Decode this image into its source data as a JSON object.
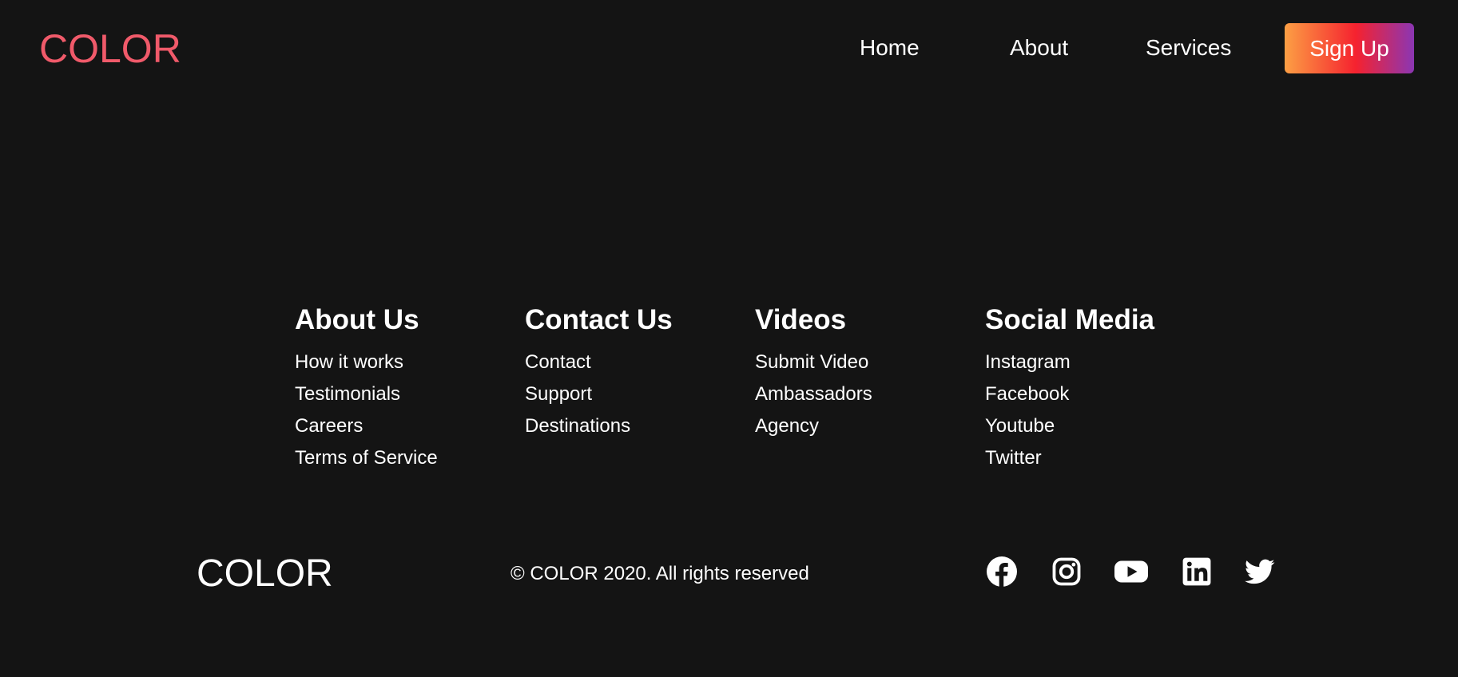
{
  "navbar": {
    "logo": "COLOR",
    "logo_color": "#f05a6a",
    "links": [
      "Home",
      "About",
      "Services"
    ],
    "signup_label": "Sign Up",
    "signup_gradient": [
      "#fc9f44",
      "#f5222f",
      "#8b36b3"
    ]
  },
  "footer": {
    "columns": [
      {
        "title": "About Us",
        "links": [
          "How it works",
          "Testimonials",
          "Careers",
          "Terms of Service"
        ]
      },
      {
        "title": "Contact Us",
        "links": [
          "Contact",
          "Support",
          "Destinations"
        ]
      },
      {
        "title": "Videos",
        "links": [
          "Submit Video",
          "Ambassadors",
          "Agency"
        ]
      },
      {
        "title": "Social Media",
        "links": [
          "Instagram",
          "Facebook",
          "Youtube",
          "Twitter"
        ]
      }
    ],
    "logo": "COLOR",
    "copyright": "© COLOR 2020. All rights reserved",
    "social_icons": [
      "facebook-icon",
      "instagram-icon",
      "youtube-icon",
      "linkedin-icon",
      "twitter-icon"
    ]
  },
  "colors": {
    "background": "#141414",
    "text": "#ffffff"
  }
}
